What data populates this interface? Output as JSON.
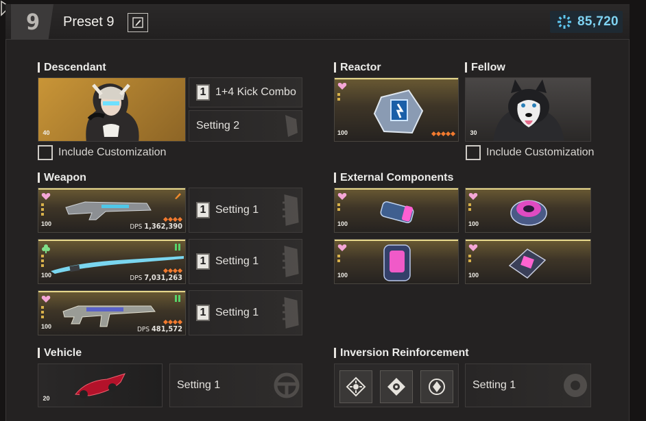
{
  "header": {
    "preset_number": "9",
    "preset_title": "Preset 9",
    "currency_value": "85,720"
  },
  "descendant": {
    "title": "Descendant",
    "level": "40",
    "skill_slot": "1",
    "skill_label": "1+4 Kick Combo",
    "setting_label": "Setting 2",
    "include_customization": "Include Customization"
  },
  "reactor": {
    "title": "Reactor",
    "level": "100"
  },
  "fellow": {
    "title": "Fellow",
    "level": "30",
    "include_customization": "Include Customization"
  },
  "weapon": {
    "title": "Weapon",
    "items": [
      {
        "level": "100",
        "dps_label": "DPS",
        "dps": "1,362,390",
        "slot": "1",
        "setting": "Setting 1"
      },
      {
        "level": "100",
        "dps_label": "DPS",
        "dps": "7,031,263",
        "slot": "1",
        "setting": "Setting 1"
      },
      {
        "level": "100",
        "dps_label": "DPS",
        "dps": "481,572",
        "slot": "1",
        "setting": "Setting 1"
      }
    ]
  },
  "external_components": {
    "title": "External Components",
    "items": [
      {
        "level": "100"
      },
      {
        "level": "100"
      },
      {
        "level": "100"
      },
      {
        "level": "100"
      }
    ]
  },
  "vehicle": {
    "title": "Vehicle",
    "level": "20",
    "setting": "Setting 1"
  },
  "inversion": {
    "title": "Inversion Reinforcement",
    "setting": "Setting 1"
  },
  "colors": {
    "accent_cyan": "#7fd3f2",
    "gold_line": "#e8d98c",
    "star_orange": "#f17a2f",
    "heart_pink": "#f4a6d6"
  }
}
